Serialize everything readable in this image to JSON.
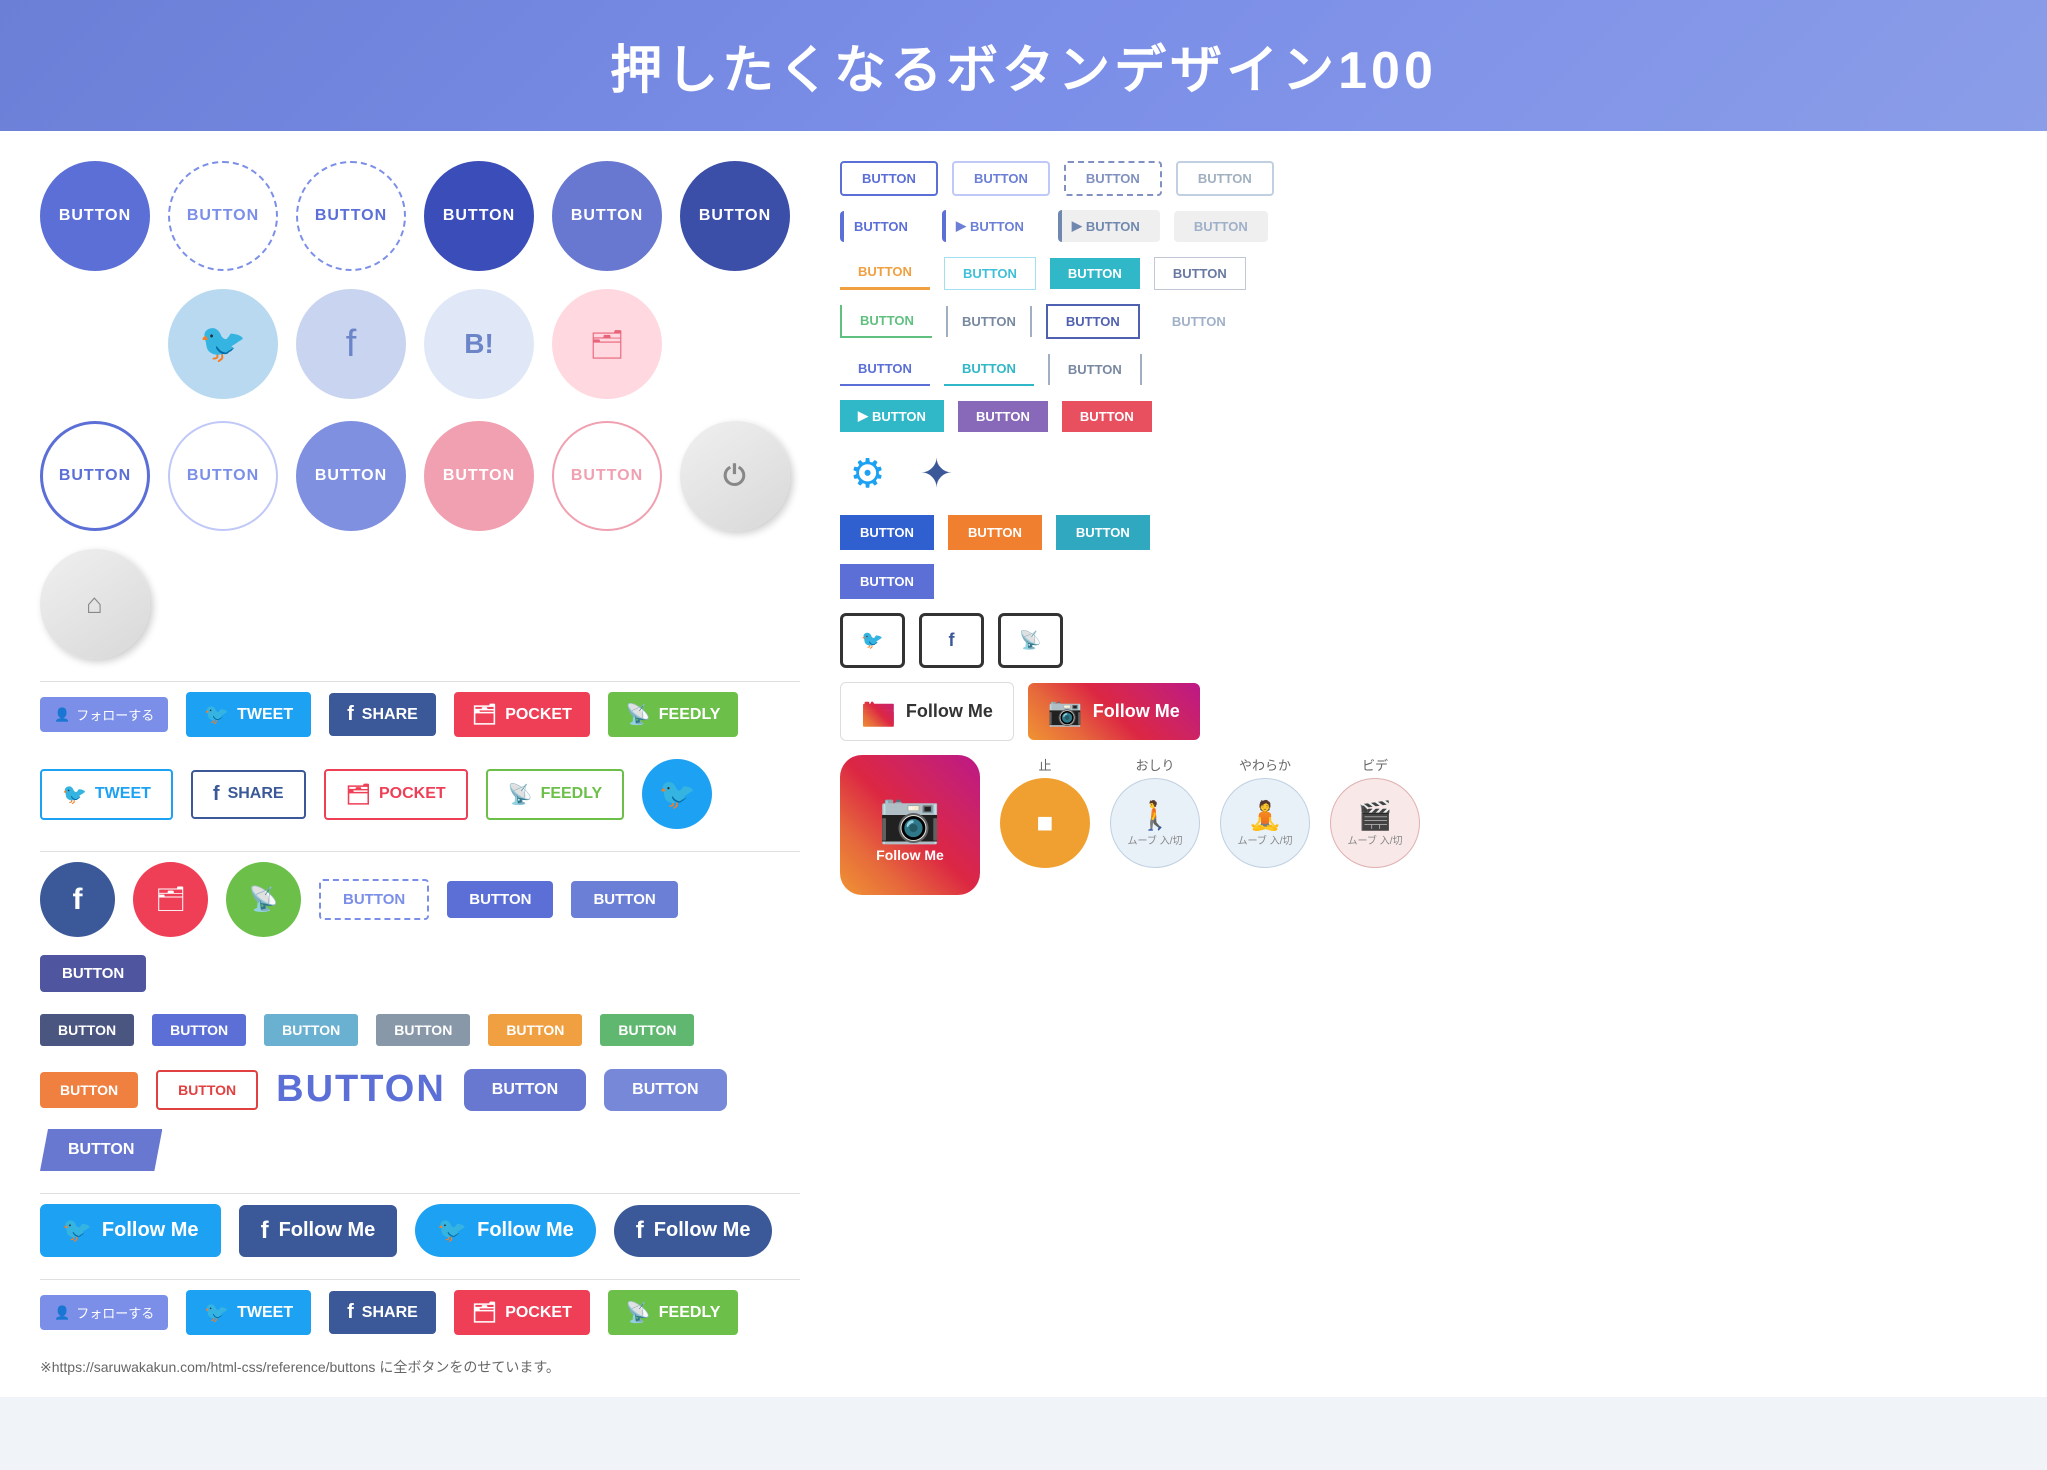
{
  "header": {
    "title": "押したくなるボタンデザイン100"
  },
  "buttons": {
    "button_label": "BUTTON",
    "tweet_label": "TWEET",
    "share_label": "SHARE",
    "pocket_label": "POCKET",
    "feedly_label": "FEEDLY",
    "follow_me_label": "Follow Me",
    "follow_jp_label": "フォローする",
    "footnote": "※https://saruwakakun.com/html-css/reference/buttons に全ボタンをのせています。"
  },
  "anim": {
    "stop_label": "止",
    "stop_sub": "",
    "move_label": "おしり",
    "move_sub": "ムーブ\n入/切",
    "soft_label": "やわらか",
    "soft_sub": "ムーブ\n入/切",
    "video_label": "ビデ",
    "video_sub": "ムーブ\n入/切"
  }
}
